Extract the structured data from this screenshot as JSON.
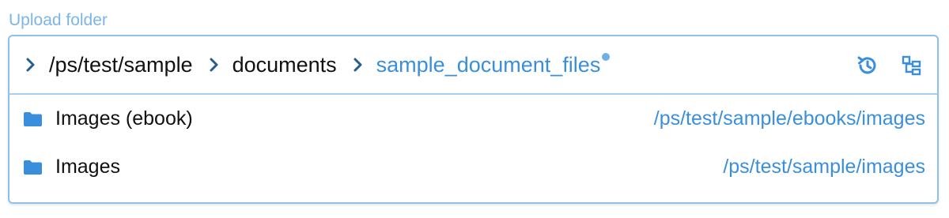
{
  "field": {
    "label": "Upload folder"
  },
  "breadcrumb": {
    "items": [
      {
        "label": "/ps/test/sample"
      },
      {
        "label": "documents"
      },
      {
        "label": "sample_document_files",
        "current": true
      }
    ]
  },
  "actions": {
    "history_icon": "history-icon",
    "tree_icon": "folder-tree-icon"
  },
  "folders": [
    {
      "name": "Images (ebook)",
      "path": "/ps/test/sample/ebooks/images",
      "icon": "folder-icon"
    },
    {
      "name": "Images",
      "path": "/ps/test/sample/images",
      "icon": "folder-icon"
    }
  ],
  "colors": {
    "accent": "#3a8fdc",
    "label": "#7ab6e8",
    "border": "#8ec1ea",
    "chevron": "#245d8f"
  }
}
